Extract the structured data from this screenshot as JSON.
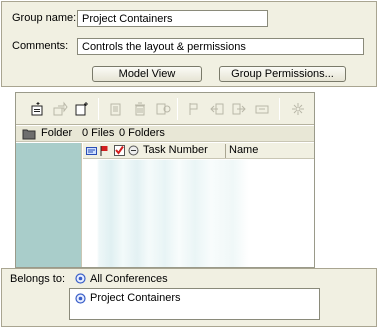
{
  "form": {
    "group_name_label": "Group name:",
    "group_name_value": "Project Containers",
    "comments_label": "Comments:",
    "comments_value": "Controls the layout & permissions",
    "model_view_button": "Model View",
    "group_permissions_button": "Group Permissions..."
  },
  "toolbar": {
    "icons": [
      "new-document-icon",
      "move-icon",
      "new-folder-icon",
      "copy-icon",
      "delete-icon",
      "properties-icon",
      "flag-icon",
      "import-icon",
      "export-icon",
      "link-icon",
      "settings-icon"
    ]
  },
  "folder_bar": {
    "folder_label": "Folder",
    "files_count": "0 Files",
    "folders_count": "0 Folders"
  },
  "grid": {
    "columns": [
      "Task Number",
      "Name"
    ]
  },
  "belongs_to": {
    "label": "Belongs to:",
    "parent": "All Conferences",
    "items": [
      "Project Containers"
    ]
  },
  "colors": {
    "panel_bg": "#f1f0e2",
    "tree_bg": "#a9cdca",
    "accent_red": "#d21f1f",
    "conference_icon": "#3a5fc8"
  }
}
